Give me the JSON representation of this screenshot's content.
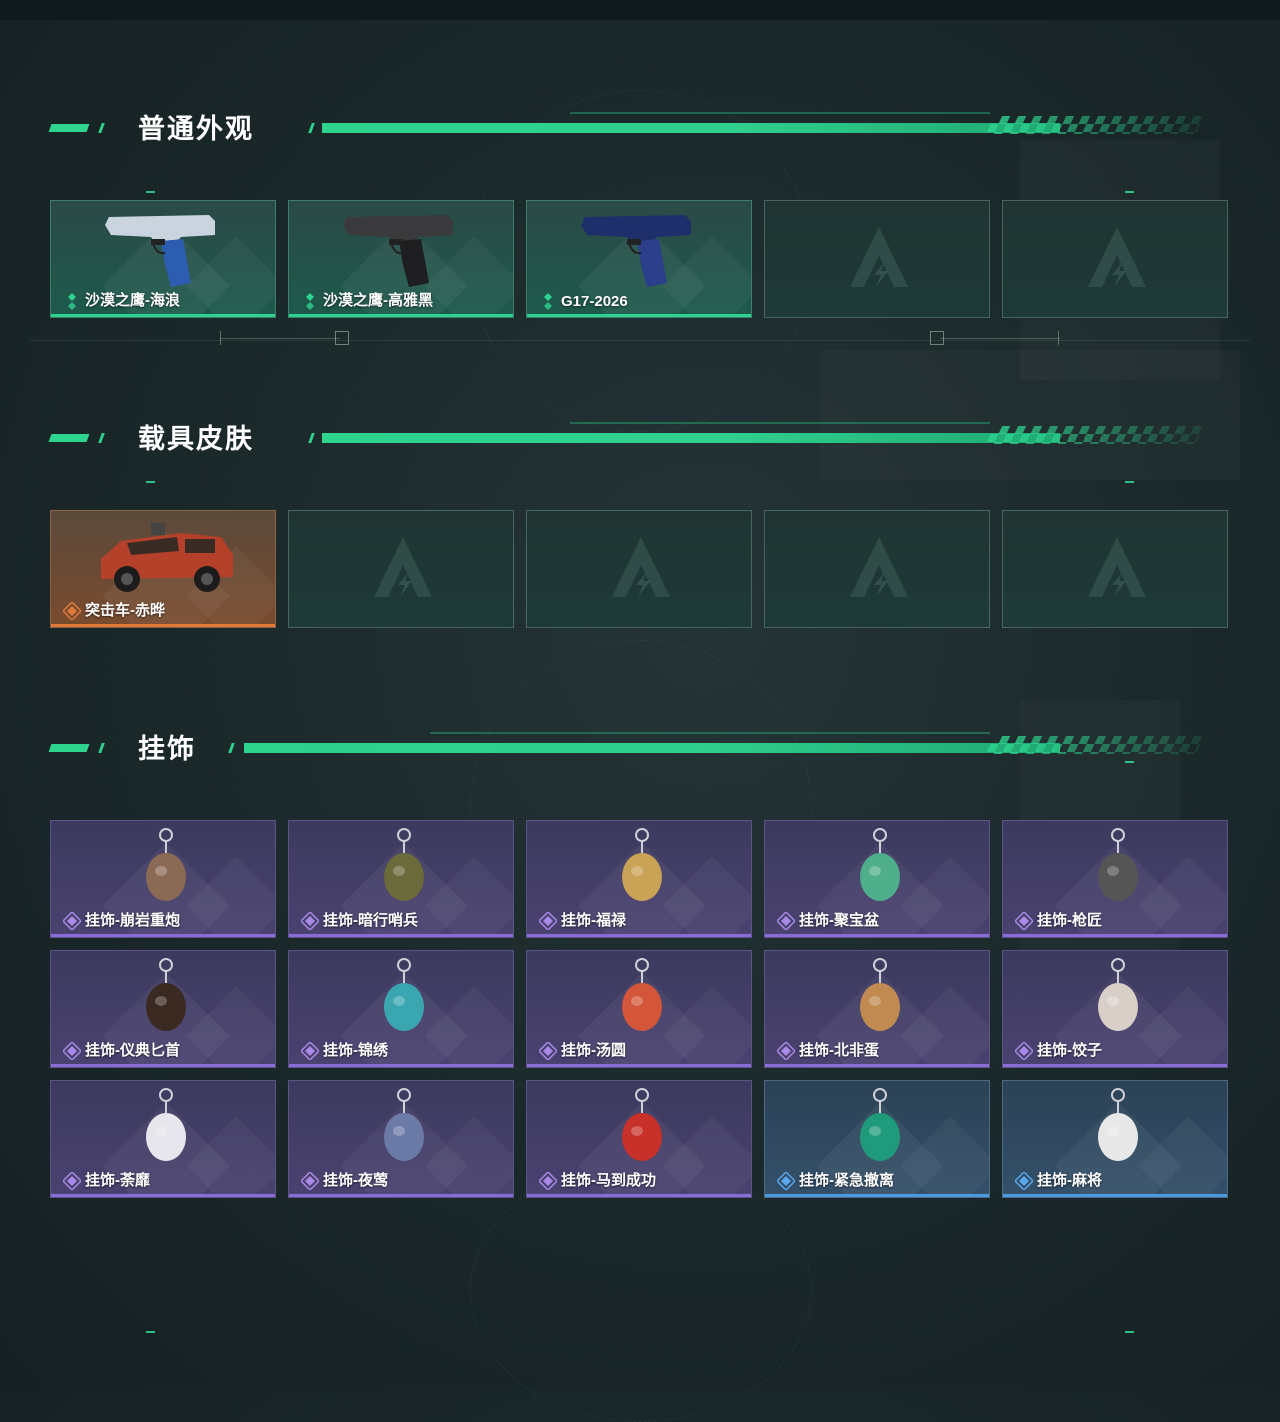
{
  "sections": [
    {
      "title": "普通外观",
      "items": [
        {
          "label": "沙漠之鹰-海浪",
          "rarity": "green",
          "icon": "pistol-icon"
        },
        {
          "label": "沙漠之鹰-高雅黑",
          "rarity": "green",
          "icon": "pistol-icon"
        },
        {
          "label": "G17-2026",
          "rarity": "green",
          "icon": "pistol-icon"
        },
        {
          "label": "",
          "rarity": "empty",
          "icon": "placeholder-logo-icon"
        },
        {
          "label": "",
          "rarity": "empty",
          "icon": "placeholder-logo-icon"
        }
      ]
    },
    {
      "title": "载具皮肤",
      "items": [
        {
          "label": "突击车-赤晔",
          "rarity": "orange",
          "icon": "vehicle-icon"
        },
        {
          "label": "",
          "rarity": "empty",
          "icon": "placeholder-logo-icon"
        },
        {
          "label": "",
          "rarity": "empty",
          "icon": "placeholder-logo-icon"
        },
        {
          "label": "",
          "rarity": "empty",
          "icon": "placeholder-logo-icon"
        },
        {
          "label": "",
          "rarity": "empty",
          "icon": "placeholder-logo-icon"
        }
      ]
    },
    {
      "title": "挂饰",
      "items": [
        {
          "label": "挂饰-崩岩重炮",
          "rarity": "purple",
          "icon": "charm-icon"
        },
        {
          "label": "挂饰-暗行哨兵",
          "rarity": "purple",
          "icon": "charm-icon"
        },
        {
          "label": "挂饰-福禄",
          "rarity": "purple",
          "icon": "charm-icon"
        },
        {
          "label": "挂饰-聚宝盆",
          "rarity": "purple",
          "icon": "charm-icon"
        },
        {
          "label": "挂饰-枪匠",
          "rarity": "purple",
          "icon": "charm-icon"
        },
        {
          "label": "挂饰-仪典匕首",
          "rarity": "purple",
          "icon": "charm-icon"
        },
        {
          "label": "挂饰-锦绣",
          "rarity": "purple",
          "icon": "charm-icon"
        },
        {
          "label": "挂饰-汤圆",
          "rarity": "purple",
          "icon": "charm-icon"
        },
        {
          "label": "挂饰-北非蛋",
          "rarity": "purple",
          "icon": "charm-icon"
        },
        {
          "label": "挂饰-饺子",
          "rarity": "purple",
          "icon": "charm-icon"
        },
        {
          "label": "挂饰-荼靡",
          "rarity": "purple",
          "icon": "charm-icon"
        },
        {
          "label": "挂饰-夜莺",
          "rarity": "purple",
          "icon": "charm-icon"
        },
        {
          "label": "挂饰-马到成功",
          "rarity": "purple",
          "icon": "charm-icon"
        },
        {
          "label": "挂饰-紧急撤离",
          "rarity": "blue",
          "icon": "charm-icon"
        },
        {
          "label": "挂饰-麻将",
          "rarity": "blue",
          "icon": "charm-icon"
        }
      ]
    }
  ],
  "colors": {
    "accent": "#2ed38e",
    "green": "#2ed38e",
    "orange": "#e07a3a",
    "purple": "#8a6cd8",
    "blue": "#4b9adf"
  }
}
